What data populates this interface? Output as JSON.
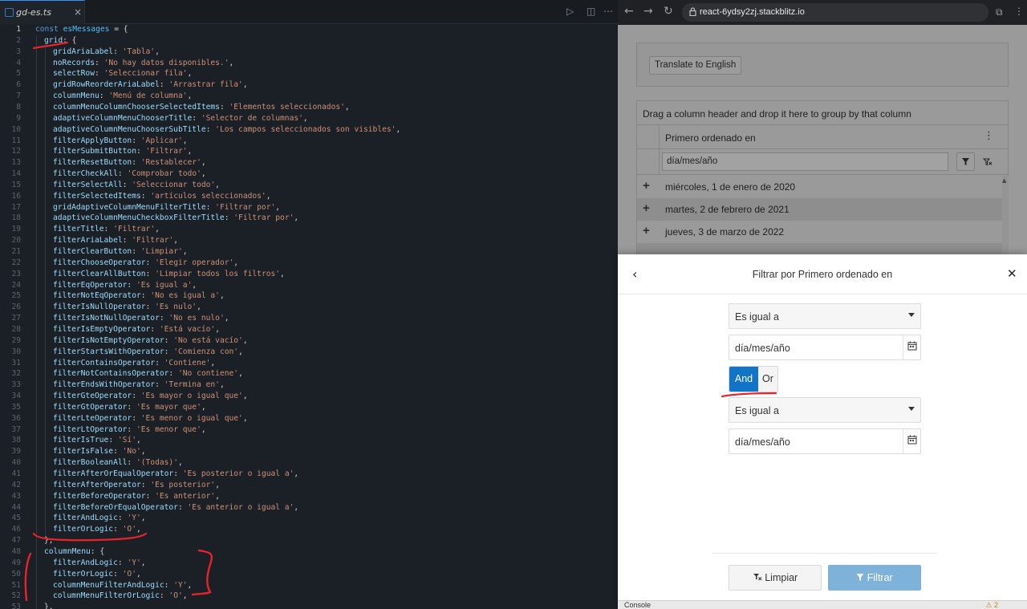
{
  "editor": {
    "tab_label": "gd-es.ts",
    "tab_close": "×",
    "active_line": 1,
    "lines": [
      {
        "n": "1",
        "indent": 0,
        "parts": [
          [
            "k",
            "const "
          ],
          [
            "v",
            "esMessages"
          ],
          [
            "o",
            " = {"
          ]
        ]
      },
      {
        "n": "2",
        "indent": 1,
        "parts": [
          [
            "p",
            "grid"
          ],
          [
            "o",
            ": {"
          ]
        ]
      },
      {
        "n": "3",
        "indent": 2,
        "parts": [
          [
            "p",
            "gridAriaLabel"
          ],
          [
            "o",
            ": "
          ],
          [
            "s",
            "'Tabla'"
          ],
          [
            "o",
            ","
          ]
        ]
      },
      {
        "n": "4",
        "indent": 2,
        "parts": [
          [
            "p",
            "noRecords"
          ],
          [
            "o",
            ": "
          ],
          [
            "s",
            "'No hay datos disponibles.'"
          ],
          [
            "o",
            ","
          ]
        ]
      },
      {
        "n": "5",
        "indent": 2,
        "parts": [
          [
            "p",
            "selectRow"
          ],
          [
            "o",
            ": "
          ],
          [
            "s",
            "'Seleccionar fila'"
          ],
          [
            "o",
            ","
          ]
        ]
      },
      {
        "n": "6",
        "indent": 2,
        "parts": [
          [
            "p",
            "gridRowReorderAriaLabel"
          ],
          [
            "o",
            ": "
          ],
          [
            "s",
            "'Arrastrar fila'"
          ],
          [
            "o",
            ","
          ]
        ]
      },
      {
        "n": "7",
        "indent": 2,
        "parts": [
          [
            "p",
            "columnMenu"
          ],
          [
            "o",
            ": "
          ],
          [
            "s",
            "'Menú de columna'"
          ],
          [
            "o",
            ","
          ]
        ]
      },
      {
        "n": "8",
        "indent": 2,
        "parts": [
          [
            "p",
            "columnMenuColumnChooserSelectedItems"
          ],
          [
            "o",
            ": "
          ],
          [
            "s",
            "'Elementos seleccionados'"
          ],
          [
            "o",
            ","
          ]
        ]
      },
      {
        "n": "9",
        "indent": 2,
        "parts": [
          [
            "p",
            "adaptiveColumnMenuChooserTitle"
          ],
          [
            "o",
            ": "
          ],
          [
            "s",
            "'Selector de columnas'"
          ],
          [
            "o",
            ","
          ]
        ]
      },
      {
        "n": "10",
        "indent": 2,
        "parts": [
          [
            "p",
            "adaptiveColumnMenuChooserSubTitle"
          ],
          [
            "o",
            ": "
          ],
          [
            "s",
            "'Los campos seleccionados son visibles'"
          ],
          [
            "o",
            ","
          ]
        ]
      },
      {
        "n": "11",
        "indent": 2,
        "parts": [
          [
            "p",
            "filterApplyButton"
          ],
          [
            "o",
            ": "
          ],
          [
            "s",
            "'Aplicar'"
          ],
          [
            "o",
            ","
          ]
        ]
      },
      {
        "n": "12",
        "indent": 2,
        "parts": [
          [
            "p",
            "filterSubmitButton"
          ],
          [
            "o",
            ": "
          ],
          [
            "s",
            "'Filtrar'"
          ],
          [
            "o",
            ","
          ]
        ]
      },
      {
        "n": "13",
        "indent": 2,
        "parts": [
          [
            "p",
            "filterResetButton"
          ],
          [
            "o",
            ": "
          ],
          [
            "s",
            "'Restablecer'"
          ],
          [
            "o",
            ","
          ]
        ]
      },
      {
        "n": "14",
        "indent": 2,
        "parts": [
          [
            "p",
            "filterCheckAll"
          ],
          [
            "o",
            ": "
          ],
          [
            "s",
            "'Comprobar todo'"
          ],
          [
            "o",
            ","
          ]
        ]
      },
      {
        "n": "15",
        "indent": 2,
        "parts": [
          [
            "p",
            "filterSelectAll"
          ],
          [
            "o",
            ": "
          ],
          [
            "s",
            "'Seleccionar todo'"
          ],
          [
            "o",
            ","
          ]
        ]
      },
      {
        "n": "16",
        "indent": 2,
        "parts": [
          [
            "p",
            "filterSelectedItems"
          ],
          [
            "o",
            ": "
          ],
          [
            "s",
            "'artículos seleccionados'"
          ],
          [
            "o",
            ","
          ]
        ]
      },
      {
        "n": "17",
        "indent": 2,
        "parts": [
          [
            "p",
            "gridAdaptiveColumnMenuFilterTitle"
          ],
          [
            "o",
            ": "
          ],
          [
            "s",
            "'Filtrar por'"
          ],
          [
            "o",
            ","
          ]
        ]
      },
      {
        "n": "18",
        "indent": 2,
        "parts": [
          [
            "p",
            "adaptiveColumnMenuCheckboxFilterTitle"
          ],
          [
            "o",
            ": "
          ],
          [
            "s",
            "'Filtrar por'"
          ],
          [
            "o",
            ","
          ]
        ]
      },
      {
        "n": "19",
        "indent": 2,
        "parts": [
          [
            "p",
            "filterTitle"
          ],
          [
            "o",
            ": "
          ],
          [
            "s",
            "'Filtrar'"
          ],
          [
            "o",
            ","
          ]
        ]
      },
      {
        "n": "20",
        "indent": 2,
        "parts": [
          [
            "p",
            "filterAriaLabel"
          ],
          [
            "o",
            ": "
          ],
          [
            "s",
            "'Filtrar'"
          ],
          [
            "o",
            ","
          ]
        ]
      },
      {
        "n": "21",
        "indent": 2,
        "parts": [
          [
            "p",
            "filterClearButton"
          ],
          [
            "o",
            ": "
          ],
          [
            "s",
            "'Limpiar'"
          ],
          [
            "o",
            ","
          ]
        ]
      },
      {
        "n": "22",
        "indent": 2,
        "parts": [
          [
            "p",
            "filterChooseOperator"
          ],
          [
            "o",
            ": "
          ],
          [
            "s",
            "'Elegir operador'"
          ],
          [
            "o",
            ","
          ]
        ]
      },
      {
        "n": "23",
        "indent": 2,
        "parts": [
          [
            "p",
            "filterClearAllButton"
          ],
          [
            "o",
            ": "
          ],
          [
            "s",
            "'Limpiar todos los filtros'"
          ],
          [
            "o",
            ","
          ]
        ]
      },
      {
        "n": "24",
        "indent": 2,
        "parts": [
          [
            "p",
            "filterEqOperator"
          ],
          [
            "o",
            ": "
          ],
          [
            "s",
            "'Es igual a'"
          ],
          [
            "o",
            ","
          ]
        ]
      },
      {
        "n": "25",
        "indent": 2,
        "parts": [
          [
            "p",
            "filterNotEqOperator"
          ],
          [
            "o",
            ": "
          ],
          [
            "s",
            "'No es igual a'"
          ],
          [
            "o",
            ","
          ]
        ]
      },
      {
        "n": "26",
        "indent": 2,
        "parts": [
          [
            "p",
            "filterIsNullOperator"
          ],
          [
            "o",
            ": "
          ],
          [
            "s",
            "'Es nulo'"
          ],
          [
            "o",
            ","
          ]
        ]
      },
      {
        "n": "27",
        "indent": 2,
        "parts": [
          [
            "p",
            "filterIsNotNullOperator"
          ],
          [
            "o",
            ": "
          ],
          [
            "s",
            "'No es nulo'"
          ],
          [
            "o",
            ","
          ]
        ]
      },
      {
        "n": "28",
        "indent": 2,
        "parts": [
          [
            "p",
            "filterIsEmptyOperator"
          ],
          [
            "o",
            ": "
          ],
          [
            "s",
            "'Está vacío'"
          ],
          [
            "o",
            ","
          ]
        ]
      },
      {
        "n": "29",
        "indent": 2,
        "parts": [
          [
            "p",
            "filterIsNotEmptyOperator"
          ],
          [
            "o",
            ": "
          ],
          [
            "s",
            "'No está vacío'"
          ],
          [
            "o",
            ","
          ]
        ]
      },
      {
        "n": "30",
        "indent": 2,
        "parts": [
          [
            "p",
            "filterStartsWithOperator"
          ],
          [
            "o",
            ": "
          ],
          [
            "s",
            "'Comienza con'"
          ],
          [
            "o",
            ","
          ]
        ]
      },
      {
        "n": "31",
        "indent": 2,
        "parts": [
          [
            "p",
            "filterContainsOperator"
          ],
          [
            "o",
            ": "
          ],
          [
            "s",
            "'Contiene'"
          ],
          [
            "o",
            ","
          ]
        ]
      },
      {
        "n": "32",
        "indent": 2,
        "parts": [
          [
            "p",
            "filterNotContainsOperator"
          ],
          [
            "o",
            ": "
          ],
          [
            "s",
            "'No contiene'"
          ],
          [
            "o",
            ","
          ]
        ]
      },
      {
        "n": "33",
        "indent": 2,
        "parts": [
          [
            "p",
            "filterEndsWithOperator"
          ],
          [
            "o",
            ": "
          ],
          [
            "s",
            "'Termina en'"
          ],
          [
            "o",
            ","
          ]
        ]
      },
      {
        "n": "34",
        "indent": 2,
        "parts": [
          [
            "p",
            "filterGteOperator"
          ],
          [
            "o",
            ": "
          ],
          [
            "s",
            "'Es mayor o igual que'"
          ],
          [
            "o",
            ","
          ]
        ]
      },
      {
        "n": "35",
        "indent": 2,
        "parts": [
          [
            "p",
            "filterGtOperator"
          ],
          [
            "o",
            ": "
          ],
          [
            "s",
            "'Es mayor que'"
          ],
          [
            "o",
            ","
          ]
        ]
      },
      {
        "n": "36",
        "indent": 2,
        "parts": [
          [
            "p",
            "filterLteOperator"
          ],
          [
            "o",
            ": "
          ],
          [
            "s",
            "'Es menor o igual que'"
          ],
          [
            "o",
            ","
          ]
        ]
      },
      {
        "n": "37",
        "indent": 2,
        "parts": [
          [
            "p",
            "filterLtOperator"
          ],
          [
            "o",
            ": "
          ],
          [
            "s",
            "'Es menor que'"
          ],
          [
            "o",
            ","
          ]
        ]
      },
      {
        "n": "38",
        "indent": 2,
        "parts": [
          [
            "p",
            "filterIsTrue"
          ],
          [
            "o",
            ": "
          ],
          [
            "s",
            "'Sí'"
          ],
          [
            "o",
            ","
          ]
        ]
      },
      {
        "n": "39",
        "indent": 2,
        "parts": [
          [
            "p",
            "filterIsFalse"
          ],
          [
            "o",
            ": "
          ],
          [
            "s",
            "'No'"
          ],
          [
            "o",
            ","
          ]
        ]
      },
      {
        "n": "40",
        "indent": 2,
        "parts": [
          [
            "p",
            "filterBooleanAll"
          ],
          [
            "o",
            ": "
          ],
          [
            "s",
            "'(Todas)'"
          ],
          [
            "o",
            ","
          ]
        ]
      },
      {
        "n": "41",
        "indent": 2,
        "parts": [
          [
            "p",
            "filterAfterOrEqualOperator"
          ],
          [
            "o",
            ": "
          ],
          [
            "s",
            "'Es posterior o igual a'"
          ],
          [
            "o",
            ","
          ]
        ]
      },
      {
        "n": "42",
        "indent": 2,
        "parts": [
          [
            "p",
            "filterAfterOperator"
          ],
          [
            "o",
            ": "
          ],
          [
            "s",
            "'Es posterior'"
          ],
          [
            "o",
            ","
          ]
        ]
      },
      {
        "n": "43",
        "indent": 2,
        "parts": [
          [
            "p",
            "filterBeforeOperator"
          ],
          [
            "o",
            ": "
          ],
          [
            "s",
            "'Es anterior'"
          ],
          [
            "o",
            ","
          ]
        ]
      },
      {
        "n": "44",
        "indent": 2,
        "parts": [
          [
            "p",
            "filterBeforeOrEqualOperator"
          ],
          [
            "o",
            ": "
          ],
          [
            "s",
            "'Es anterior o igual a'"
          ],
          [
            "o",
            ","
          ]
        ]
      },
      {
        "n": "45",
        "indent": 2,
        "parts": [
          [
            "p",
            "filterAndLogic"
          ],
          [
            "o",
            ": "
          ],
          [
            "s",
            "'Y'"
          ],
          [
            "o",
            ","
          ]
        ]
      },
      {
        "n": "46",
        "indent": 2,
        "parts": [
          [
            "p",
            "filterOrLogic"
          ],
          [
            "o",
            ": "
          ],
          [
            "s",
            "'O'"
          ],
          [
            "o",
            ","
          ]
        ]
      },
      {
        "n": "47",
        "indent": 1,
        "parts": [
          [
            "o",
            "},"
          ]
        ]
      },
      {
        "n": "48",
        "indent": 1,
        "parts": [
          [
            "p",
            "columnMenu"
          ],
          [
            "o",
            ": {"
          ]
        ]
      },
      {
        "n": "49",
        "indent": 2,
        "parts": [
          [
            "p",
            "filterAndLogic"
          ],
          [
            "o",
            ": "
          ],
          [
            "s",
            "'Y'"
          ],
          [
            "o",
            ","
          ]
        ]
      },
      {
        "n": "50",
        "indent": 2,
        "parts": [
          [
            "p",
            "filterOrLogic"
          ],
          [
            "o",
            ": "
          ],
          [
            "s",
            "'O'"
          ],
          [
            "o",
            ","
          ]
        ]
      },
      {
        "n": "51",
        "indent": 2,
        "parts": [
          [
            "p",
            "columnMenuFilterAndLogic"
          ],
          [
            "o",
            ": "
          ],
          [
            "s",
            "'Y'"
          ],
          [
            "o",
            ","
          ]
        ]
      },
      {
        "n": "52",
        "indent": 2,
        "parts": [
          [
            "p",
            "columnMenuFilterOrLogic"
          ],
          [
            "o",
            ": "
          ],
          [
            "s",
            "'O'"
          ],
          [
            "o",
            ","
          ]
        ]
      },
      {
        "n": "53",
        "indent": 1,
        "parts": [
          [
            "o",
            "},"
          ]
        ]
      }
    ]
  },
  "browser": {
    "url": "react-6ydsy2zj.stackblitz.io",
    "translate_button": "Translate to English",
    "grid": {
      "group_panel_text": "Drag a column header and drop it here to group by that column",
      "column_title": "Primero ordenado en",
      "filter_placeholder": "día/mes/año",
      "rows": [
        "miércoles, 1 de enero de 2020",
        "martes, 2 de febrero de 2021",
        "jueves, 3 de marzo de 2022"
      ]
    },
    "console_label": "Console",
    "console_warnings": "2"
  },
  "popup": {
    "title": "Filtrar por Primero ordenado en",
    "operator_1": "Es igual a",
    "date_1_placeholder": "día/mes/año",
    "logic_and": "And",
    "logic_or": "Or",
    "operator_2": "Es igual a",
    "date_2_placeholder": "día/mes/año",
    "clear_button": "Limpiar",
    "filter_button": "Filtrar"
  },
  "colors": {
    "and_active": "#1174c7",
    "filter_button": "#7fb2d9",
    "annotation": "#e8232b"
  }
}
